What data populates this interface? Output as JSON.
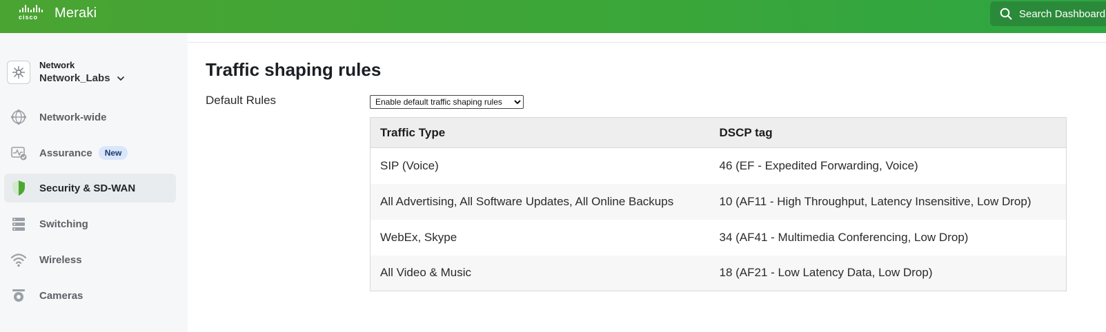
{
  "brand": {
    "company": "cisco",
    "product": "Meraki"
  },
  "search": {
    "label": "Search Dashboard"
  },
  "network": {
    "caption": "Network",
    "name": "Network_Labs"
  },
  "nav": [
    {
      "label": "Network-wide",
      "icon": "network-wide-icon"
    },
    {
      "label": "Assurance",
      "icon": "assurance-icon",
      "badge": "New"
    },
    {
      "label": "Security & SD-WAN",
      "icon": "shield-icon",
      "active": true
    },
    {
      "label": "Switching",
      "icon": "switch-icon"
    },
    {
      "label": "Wireless",
      "icon": "wifi-icon"
    },
    {
      "label": "Cameras",
      "icon": "camera-icon"
    }
  ],
  "page": {
    "title": "Traffic shaping rules",
    "default_rules_label": "Default Rules",
    "default_rules_select": {
      "selected": "Enable default traffic shaping rules",
      "options": [
        "Enable default traffic shaping rules"
      ]
    }
  },
  "table": {
    "headers": [
      "Traffic Type",
      "DSCP tag"
    ],
    "rows": [
      [
        "SIP (Voice)",
        "46 (EF - Expedited Forwarding, Voice)"
      ],
      [
        "All Advertising, All Software Updates, All Online Backups",
        "10 (AF11 - High Throughput, Latency Insensitive, Low Drop)"
      ],
      [
        "WebEx, Skype",
        "34 (AF41 - Multimedia Conferencing, Low Drop)"
      ],
      [
        "All Video & Music",
        "18 (AF21 - Low Latency Data, Low Drop)"
      ]
    ]
  },
  "colors": {
    "topbar": "#3aa63a",
    "search_button": "#2b8a3a",
    "sidebar_bg": "#f6f7f8",
    "active_item": "#e9ecee",
    "badge_bg": "#d9e6fb",
    "shield_green": "#4aa832"
  }
}
